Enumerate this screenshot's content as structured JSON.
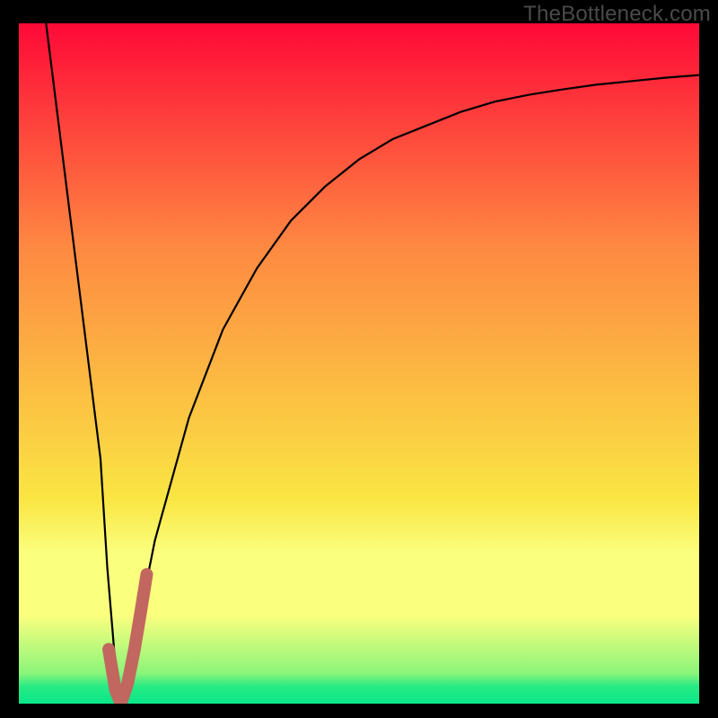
{
  "watermark": "TheBottleneck.com",
  "colors": {
    "frame": "#000000",
    "watermark": "#4a4a4a",
    "curve": "#000000",
    "marker": "#c1675f",
    "gradient_top": "#fe0937",
    "gradient_mid1": "#fe8942",
    "gradient_mid2": "#fae643",
    "gradient_band": "#fbff7e",
    "gradient_green_top": "#8cf57a",
    "gradient_green_mid": "#26eb84",
    "gradient_green_bot": "#0be789"
  },
  "chart_data": {
    "type": "line",
    "title": "",
    "xlabel": "",
    "ylabel": "",
    "xlim": [
      0,
      100
    ],
    "ylim": [
      0,
      100
    ],
    "series": [
      {
        "name": "bottleneck-curve",
        "x": [
          4,
          6,
          8,
          10,
          12,
          13,
          14,
          15,
          16,
          18,
          20,
          25,
          30,
          35,
          40,
          45,
          50,
          55,
          60,
          65,
          70,
          75,
          80,
          85,
          90,
          95,
          100
        ],
        "values": [
          100,
          84,
          68,
          52,
          36,
          20,
          8,
          0,
          3,
          14,
          24,
          42,
          55,
          64,
          71,
          76,
          80,
          83,
          85,
          87,
          88.5,
          89.5,
          90.3,
          91,
          91.5,
          92,
          92.4
        ]
      }
    ],
    "marker": {
      "name": "highlight-j",
      "x": [
        13.2,
        14.2,
        15.0,
        16.0,
        17.0,
        18.0,
        18.8
      ],
      "values": [
        8.0,
        2.0,
        0.0,
        3.0,
        8.0,
        14.0,
        19.0
      ]
    }
  }
}
